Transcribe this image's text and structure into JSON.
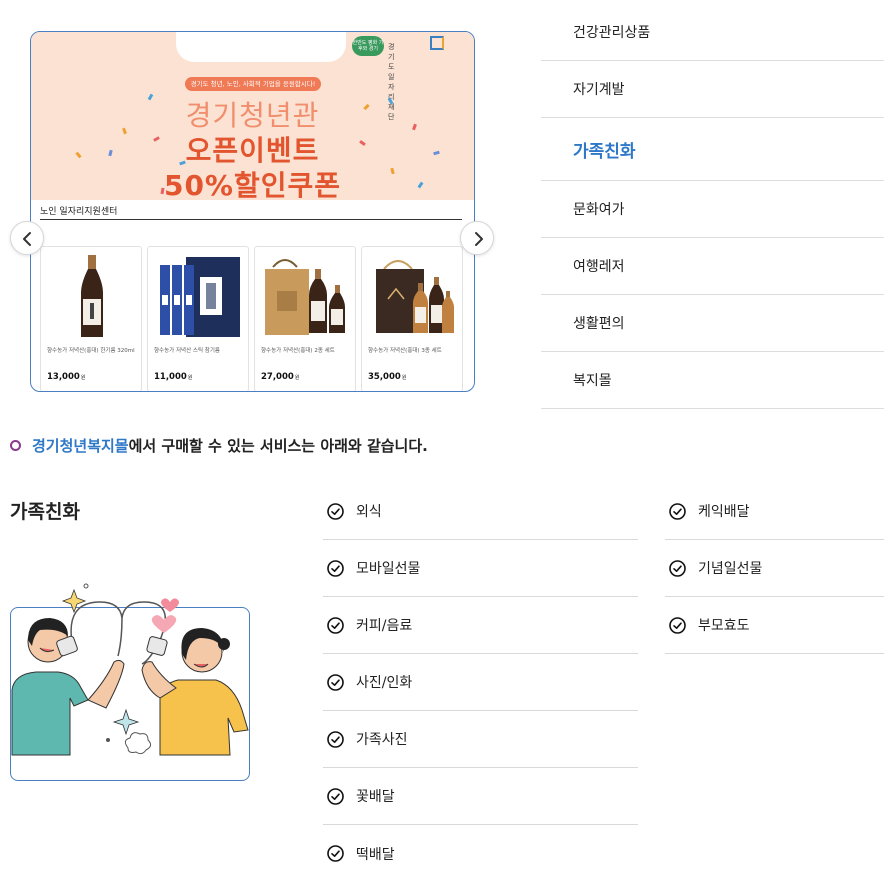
{
  "banner": {
    "logo_text": "한반도 평화 기후와 경기",
    "brand_text": "경기도일자리재단",
    "promo_pill": "경기도 청년, 노인, 사회적 기업을 응원합시다!",
    "promo_line1": "경기청년관",
    "promo_line2": "오픈이벤트",
    "promo_line3": "50%할인쿠폰",
    "shop_name": "노인 일자리지원센터",
    "products": [
      {
        "name": "향수농가 저녁산(홍대) 한기름 320ml",
        "price": "13,000",
        "unit": "원"
      },
      {
        "name": "향수농가 저녁산 스틱 참기름",
        "price": "11,000",
        "unit": "원"
      },
      {
        "name": "향수농가 저녁산(홍대) 2종 세트",
        "price": "27,000",
        "unit": "원"
      },
      {
        "name": "향수농가 저녁산(홍대) 3종 세트",
        "price": "35,000",
        "unit": "원"
      }
    ]
  },
  "categories": [
    {
      "label": "건강관리상품",
      "active": false
    },
    {
      "label": "자기계발",
      "active": false
    },
    {
      "label": "가족친화",
      "active": true
    },
    {
      "label": "문화여가",
      "active": false
    },
    {
      "label": "여행레저",
      "active": false
    },
    {
      "label": "생활편의",
      "active": false
    },
    {
      "label": "복지몰",
      "active": false
    }
  ],
  "notice": {
    "brand": "경기청년복지몰",
    "rest": "에서 구매할 수 있는 서비스는 아래와 같습니다."
  },
  "section": {
    "title": "가족친화",
    "services_col1": [
      "외식",
      "모바일선물",
      "커피/음료",
      "사진/인화",
      "가족사진",
      "꽃배달",
      "떡배달"
    ],
    "services_col2": [
      "케익배달",
      "기념일선물",
      "부모효도"
    ]
  },
  "colors": {
    "accent": "#2e78c7",
    "bullet": "#8d3a8f",
    "promo_bg": "#fbe2d3",
    "promo_red": "#e2552f"
  }
}
